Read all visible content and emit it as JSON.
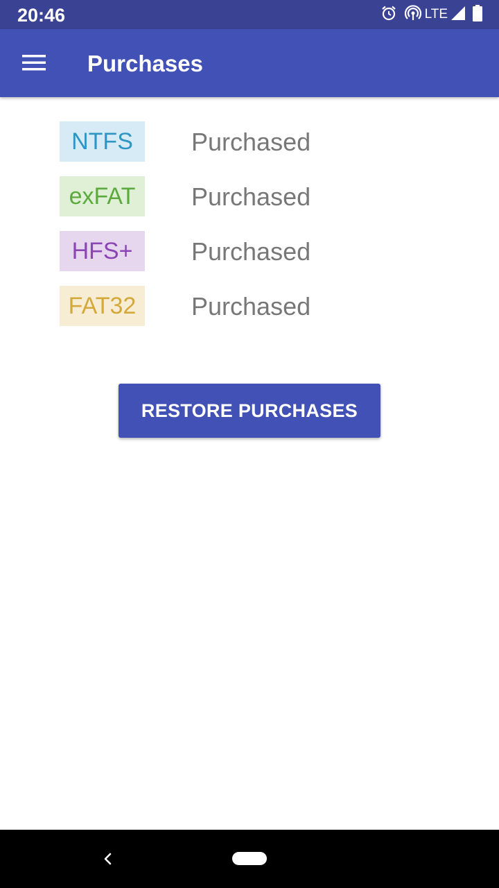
{
  "status_bar": {
    "time": "20:46",
    "network_label": "LTE",
    "icons": [
      "alarm-icon",
      "hotspot-icon",
      "signal-icon",
      "battery-icon"
    ]
  },
  "app_bar": {
    "title": "Purchases",
    "menu_icon": "hamburger-menu-icon",
    "color": "#4251b5"
  },
  "purchases": [
    {
      "name": "NTFS",
      "status": "Purchased",
      "text_color": "#2f95c4",
      "bg_color": "#d6ebf5"
    },
    {
      "name": "exFAT",
      "status": "Purchased",
      "text_color": "#5caa3e",
      "bg_color": "#dff0d7"
    },
    {
      "name": "HFS+",
      "status": "Purchased",
      "text_color": "#8b45b5",
      "bg_color": "#e6d6ee"
    },
    {
      "name": "FAT32",
      "status": "Purchased",
      "text_color": "#d4a93a",
      "bg_color": "#f6edd4"
    }
  ],
  "restore_button": {
    "label": "RESTORE PURCHASES"
  },
  "nav_bar": {
    "icons": [
      "back-icon",
      "home-pill-icon"
    ]
  }
}
